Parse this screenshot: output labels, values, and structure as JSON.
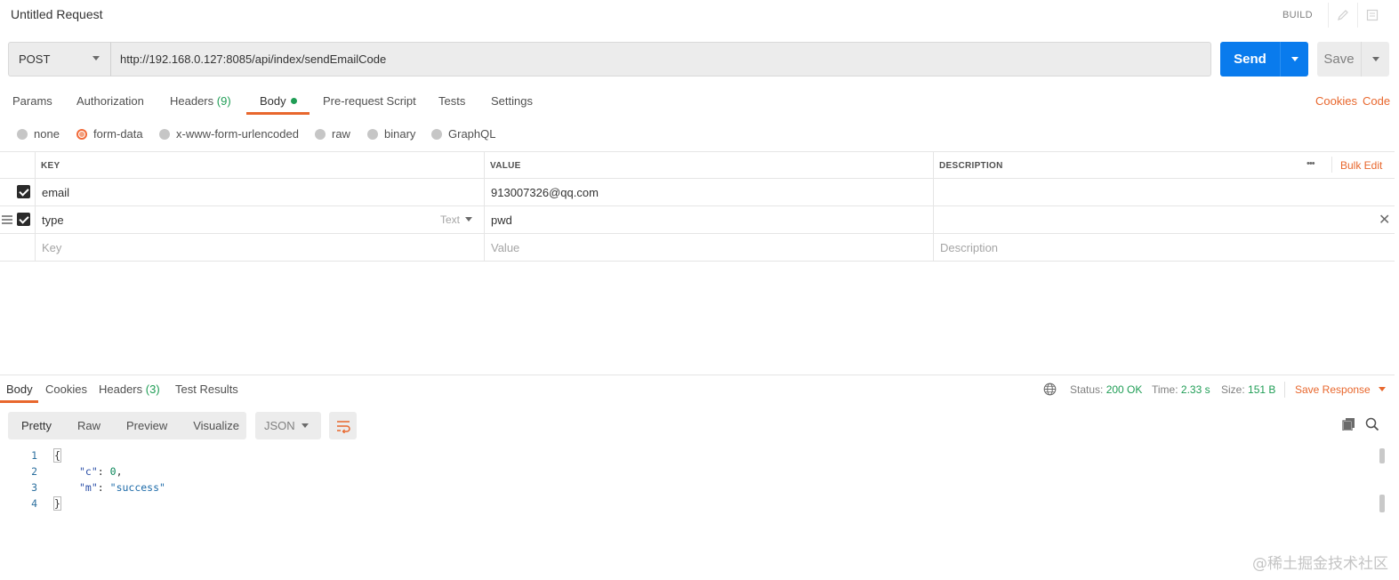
{
  "header": {
    "title": "Untitled Request",
    "build_label": "BUILD"
  },
  "request": {
    "method": "POST",
    "url": "http://192.168.0.127:8085/api/index/sendEmailCode",
    "send_label": "Send",
    "save_label": "Save"
  },
  "tabs": {
    "params": "Params",
    "authorization": "Authorization",
    "headers": "Headers",
    "headers_count": "(9)",
    "body": "Body",
    "prerequest": "Pre-request Script",
    "tests": "Tests",
    "settings": "Settings",
    "cookies": "Cookies",
    "code": "Code"
  },
  "body_types": {
    "none": "none",
    "form_data": "form-data",
    "urlencoded": "x-www-form-urlencoded",
    "raw": "raw",
    "binary": "binary",
    "graphql": "GraphQL",
    "selected": "form-data"
  },
  "form_table": {
    "headers": {
      "key": "KEY",
      "value": "VALUE",
      "description": "DESCRIPTION",
      "bulk_edit": "Bulk Edit",
      "more": "•••"
    },
    "rows": [
      {
        "key": "email",
        "value": "913007326@qq.com",
        "description": "",
        "checked": true
      },
      {
        "key": "type",
        "type_label": "Text",
        "value": "pwd",
        "description": "",
        "checked": true
      }
    ],
    "placeholder": {
      "key": "Key",
      "value": "Value",
      "description": "Description"
    }
  },
  "response": {
    "tabs": {
      "body": "Body",
      "cookies": "Cookies",
      "headers": "Headers",
      "headers_count": "(3)",
      "test_results": "Test Results"
    },
    "status_label": "Status:",
    "status_value": "200 OK",
    "time_label": "Time:",
    "time_value": "2.33 s",
    "size_label": "Size:",
    "size_value": "151 B",
    "save_response": "Save Response",
    "view_modes": {
      "pretty": "Pretty",
      "raw": "Raw",
      "preview": "Preview",
      "visualize": "Visualize"
    },
    "format": "JSON",
    "lines": [
      "1",
      "2",
      "3",
      "4"
    ],
    "json": {
      "open": "{",
      "k1": "\"c\"",
      "v1": "0",
      "k2": "\"m\"",
      "v2": "\"success\"",
      "close": "}"
    }
  },
  "watermark": "@稀土掘金技术社区"
}
